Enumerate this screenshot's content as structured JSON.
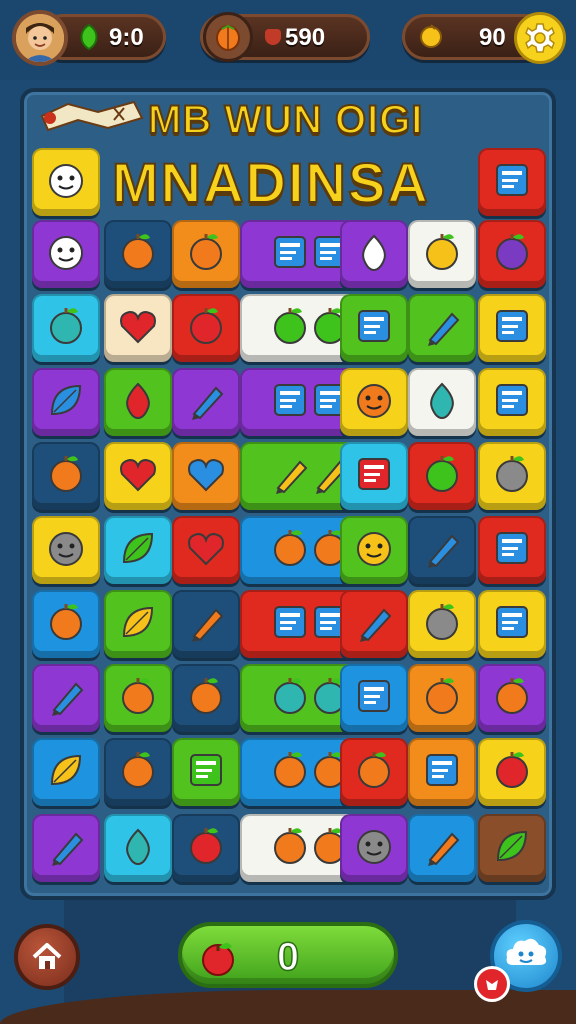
{
  "hud": {
    "lives_value": "9:0",
    "coins_value": "590",
    "gems_value": "90",
    "avatar_icon": "player-avatar",
    "lives_icon": "green-leaf-icon",
    "coins_icon": "fruit-coin-icon",
    "gems_icon": "yellow-drop-icon",
    "settings_icon": "gear-icon"
  },
  "title": {
    "line1": "MB WUN OIGI",
    "line2": "MNADINSA"
  },
  "bottom": {
    "score_value": "0",
    "home_icon": "home-icon",
    "score_icon": "apple-icon",
    "helper_icon": "cloud-face-icon",
    "badge_icon": "alert-badge-icon"
  },
  "colors": {
    "yellow": "#f6d31a",
    "purple": "#8f37d3",
    "blue": "#1e94e0",
    "navy": "#1e4f7a",
    "orange": "#f28c1a",
    "red": "#e02a1f",
    "green": "#52c21f",
    "white": "#f5f5f0",
    "cream": "#f8e6c2",
    "brown": "#8a4f2a",
    "cyan": "#2fc3e8"
  },
  "tiles": [
    {
      "color": "yellow",
      "icon": "cat-face-icon"
    },
    {
      "color": "red",
      "icon": "books-cheese-icon"
    },
    {
      "color": "purple",
      "icon": "smiley-face-icon"
    },
    {
      "color": "navy",
      "icon": "orange-pumpkin-icon"
    },
    {
      "color": "orange",
      "icon": "paint-bucket-icon"
    },
    {
      "color": "purple",
      "icon": "open-book-icon",
      "wide": true
    },
    {
      "color": "purple",
      "icon": "white-ball-icon"
    },
    {
      "color": "white",
      "icon": "yellow-lemon-icon"
    },
    {
      "color": "red",
      "icon": "purple-grapes-icon"
    },
    {
      "color": "cyan",
      "icon": "teal-apple-icon"
    },
    {
      "color": "cream",
      "icon": "red-heart-apple-icon"
    },
    {
      "color": "red",
      "icon": "red-apple-icon"
    },
    {
      "color": "white",
      "icon": "green-apples-icon",
      "wide": true
    },
    {
      "color": "green",
      "icon": "notepad-icon"
    },
    {
      "color": "green",
      "icon": "pencil-icon"
    },
    {
      "color": "yellow",
      "icon": "book-stack-icon"
    },
    {
      "color": "purple",
      "icon": "blue-bird-icon"
    },
    {
      "color": "green",
      "icon": "red-balloon-icon"
    },
    {
      "color": "purple",
      "icon": "blue-pen-icon"
    },
    {
      "color": "purple",
      "icon": "open-book-icon",
      "wide": true
    },
    {
      "color": "yellow",
      "icon": "orange-face-icon"
    },
    {
      "color": "white",
      "icon": "blue-drop-icon"
    },
    {
      "color": "yellow",
      "icon": "tablet-icon"
    },
    {
      "color": "navy",
      "icon": "orange-fruit-icon"
    },
    {
      "color": "yellow",
      "icon": "red-heart-icon"
    },
    {
      "color": "orange",
      "icon": "blue-heart-icon"
    },
    {
      "color": "green",
      "icon": "yellow-popsicles-icon",
      "wide": true
    },
    {
      "color": "cyan",
      "icon": "red-note-icon"
    },
    {
      "color": "red",
      "icon": "green-gift-icon"
    },
    {
      "color": "yellow",
      "icon": "pot-icon"
    },
    {
      "color": "yellow",
      "icon": "gray-face-icon"
    },
    {
      "color": "cyan",
      "icon": "green-leaf-icon"
    },
    {
      "color": "red",
      "icon": "red-heart-icon"
    },
    {
      "color": "blue",
      "icon": "watermelon-globe-icon",
      "wide": true
    },
    {
      "color": "green",
      "icon": "yellow-smiley-icon"
    },
    {
      "color": "navy",
      "icon": "pin-icon"
    },
    {
      "color": "red",
      "icon": "calendar-icon"
    },
    {
      "color": "blue",
      "icon": "fries-basket-icon"
    },
    {
      "color": "green",
      "icon": "yellow-bean-icon"
    },
    {
      "color": "navy",
      "icon": "orange-pen-icon"
    },
    {
      "color": "red",
      "icon": "tablet-bread-icon",
      "wide": true
    },
    {
      "color": "red",
      "icon": "blue-popsicle-icon"
    },
    {
      "color": "yellow",
      "icon": "gray-seed-icon"
    },
    {
      "color": "yellow",
      "icon": "brown-tablet-icon"
    },
    {
      "color": "purple",
      "icon": "blue-rocket-icon"
    },
    {
      "color": "green",
      "icon": "cake-icon"
    },
    {
      "color": "navy",
      "icon": "orange-flower-icon"
    },
    {
      "color": "green",
      "icon": "teal-cup-icon",
      "wide": true
    },
    {
      "color": "blue",
      "icon": "checklist-icon"
    },
    {
      "color": "orange",
      "icon": "brush-frame-icon"
    },
    {
      "color": "purple",
      "icon": "palette-icon"
    },
    {
      "color": "blue",
      "icon": "yellow-shell-icon"
    },
    {
      "color": "navy",
      "icon": "soup-bowl-icon"
    },
    {
      "color": "green",
      "icon": "green-card-icon"
    },
    {
      "color": "blue",
      "icon": "orange-fruit-icon",
      "wide": true
    },
    {
      "color": "red",
      "icon": "magnifier-icon"
    },
    {
      "color": "orange",
      "icon": "calculator-icon"
    },
    {
      "color": "yellow",
      "icon": "red-star-icon"
    },
    {
      "color": "purple",
      "icon": "crayon-icon"
    },
    {
      "color": "cyan",
      "icon": "blue-ghost-icon"
    },
    {
      "color": "navy",
      "icon": "red-kite-icon"
    },
    {
      "color": "white",
      "icon": "earth-cookie-icon",
      "wide": true
    },
    {
      "color": "purple",
      "icon": "gray-face-icon"
    },
    {
      "color": "blue",
      "icon": "orange-pencil-icon"
    },
    {
      "color": "brown",
      "icon": "green-plant-icon"
    }
  ]
}
